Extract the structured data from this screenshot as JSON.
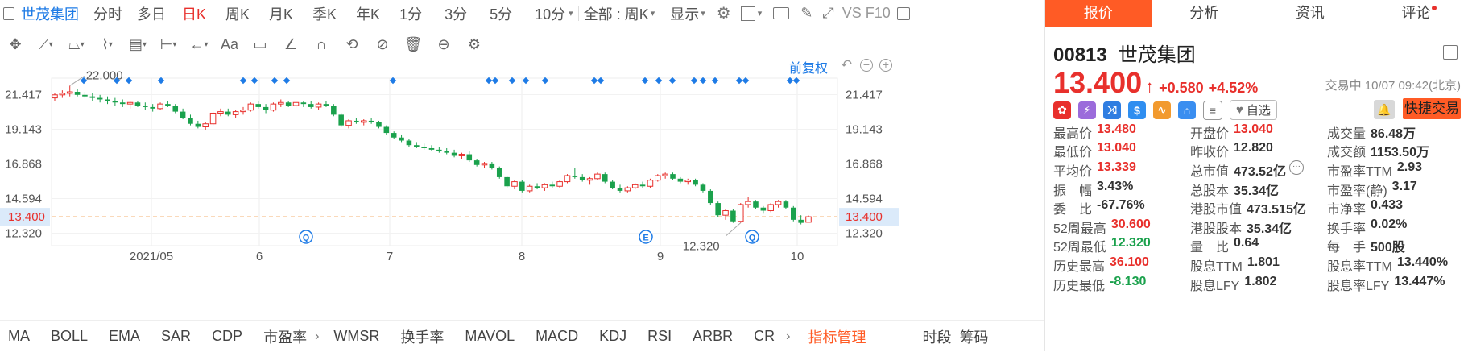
{
  "stock_name": "世茂集团",
  "periods": [
    "分时",
    "多日",
    "日K",
    "周K",
    "月K",
    "季K",
    "年K",
    "1分",
    "3分",
    "5分",
    "10分"
  ],
  "active_period": "日K",
  "range_select": "全部 : 周K",
  "display_label": "显示",
  "vs_label": "VS F10",
  "adjust_label": "前复权",
  "chart_data": {
    "type": "candlestick",
    "title": "",
    "ylim": [
      11.5,
      22.5
    ],
    "y_ticks": [
      21.417,
      19.143,
      16.868,
      14.594,
      12.32
    ],
    "y_tick_labels": [
      "21.417",
      "19.143",
      "16.868",
      "14.594",
      "12.320"
    ],
    "current_price_line": 13.4,
    "current_price_label": "13.400",
    "x_labels": [
      "2021/05",
      "6",
      "7",
      "8",
      "9",
      "10"
    ],
    "max_annotation": "22.000",
    "min_annotation": "12.320",
    "event_markers": [
      "Q",
      "E",
      "Q"
    ],
    "series": [
      {
        "values": [
          [
            21.2,
            21.5,
            21.0,
            21.4
          ],
          [
            21.4,
            21.7,
            21.2,
            21.5
          ],
          [
            21.5,
            22.0,
            21.3,
            21.6
          ],
          [
            21.6,
            21.8,
            21.3,
            21.4
          ],
          [
            21.4,
            21.6,
            21.2,
            21.3
          ],
          [
            21.3,
            21.5,
            21.0,
            21.2
          ],
          [
            21.2,
            21.4,
            20.9,
            21.1
          ],
          [
            21.1,
            21.3,
            20.8,
            21.0
          ],
          [
            21.0,
            21.2,
            20.7,
            20.9
          ],
          [
            20.9,
            21.1,
            20.6,
            20.8
          ],
          [
            20.8,
            21.0,
            20.5,
            20.9
          ],
          [
            20.9,
            21.0,
            20.6,
            20.7
          ],
          [
            20.7,
            20.9,
            20.4,
            20.6
          ],
          [
            20.6,
            20.8,
            20.3,
            20.5
          ],
          [
            20.5,
            20.9,
            20.4,
            20.8
          ],
          [
            20.8,
            21.0,
            20.6,
            20.7
          ],
          [
            20.7,
            20.8,
            20.2,
            20.3
          ],
          [
            20.3,
            20.5,
            19.8,
            19.9
          ],
          [
            19.9,
            20.1,
            19.4,
            19.5
          ],
          [
            19.5,
            19.7,
            19.2,
            19.3
          ],
          [
            19.3,
            19.6,
            19.1,
            19.5
          ],
          [
            19.5,
            20.3,
            19.4,
            20.2
          ],
          [
            20.2,
            20.5,
            20.0,
            20.3
          ],
          [
            20.3,
            20.5,
            20.0,
            20.1
          ],
          [
            20.1,
            20.4,
            19.9,
            20.3
          ],
          [
            20.3,
            20.6,
            20.1,
            20.4
          ],
          [
            20.4,
            20.9,
            20.3,
            20.8
          ],
          [
            20.8,
            21.0,
            20.5,
            20.6
          ],
          [
            20.6,
            20.8,
            20.2,
            20.4
          ],
          [
            20.4,
            20.9,
            20.3,
            20.8
          ],
          [
            20.8,
            21.1,
            20.6,
            20.9
          ],
          [
            20.9,
            21.0,
            20.6,
            20.7
          ],
          [
            20.7,
            21.0,
            20.5,
            20.9
          ],
          [
            20.9,
            21.0,
            20.6,
            20.8
          ],
          [
            20.8,
            21.0,
            20.5,
            20.6
          ],
          [
            20.6,
            20.9,
            20.4,
            20.8
          ],
          [
            20.8,
            21.0,
            20.6,
            20.7
          ],
          [
            20.7,
            20.8,
            20.0,
            20.1
          ],
          [
            20.1,
            20.2,
            19.3,
            19.4
          ],
          [
            19.4,
            19.8,
            19.2,
            19.7
          ],
          [
            19.7,
            19.9,
            19.5,
            19.6
          ],
          [
            19.6,
            19.8,
            19.4,
            19.7
          ],
          [
            19.7,
            19.9,
            19.5,
            19.6
          ],
          [
            19.6,
            19.7,
            19.2,
            19.3
          ],
          [
            19.3,
            19.4,
            18.8,
            18.9
          ],
          [
            18.9,
            19.0,
            18.5,
            18.6
          ],
          [
            18.6,
            18.8,
            18.3,
            18.4
          ],
          [
            18.4,
            18.5,
            18.0,
            18.1
          ],
          [
            18.1,
            18.3,
            17.9,
            18.0
          ],
          [
            18.0,
            18.2,
            17.8,
            17.9
          ],
          [
            17.9,
            18.1,
            17.7,
            17.8
          ],
          [
            17.8,
            18.0,
            17.6,
            17.7
          ],
          [
            17.7,
            17.9,
            17.5,
            17.6
          ],
          [
            17.6,
            17.8,
            17.3,
            17.4
          ],
          [
            17.4,
            17.6,
            17.2,
            17.5
          ],
          [
            17.5,
            17.7,
            17.0,
            17.1
          ],
          [
            17.1,
            17.2,
            16.7,
            16.8
          ],
          [
            16.8,
            17.0,
            16.6,
            16.9
          ],
          [
            16.9,
            17.0,
            16.5,
            16.6
          ],
          [
            16.6,
            16.7,
            15.9,
            16.0
          ],
          [
            16.0,
            16.1,
            15.3,
            15.4
          ],
          [
            15.4,
            15.8,
            15.2,
            15.7
          ],
          [
            15.7,
            15.8,
            15.0,
            15.1
          ],
          [
            15.1,
            15.5,
            15.0,
            15.4
          ],
          [
            15.4,
            15.6,
            15.2,
            15.3
          ],
          [
            15.3,
            15.6,
            15.1,
            15.5
          ],
          [
            15.5,
            15.7,
            15.3,
            15.4
          ],
          [
            15.4,
            15.8,
            15.3,
            15.7
          ],
          [
            15.7,
            16.2,
            15.6,
            16.1
          ],
          [
            16.1,
            16.6,
            15.9,
            16.0
          ],
          [
            16.0,
            16.2,
            15.7,
            15.8
          ],
          [
            15.8,
            16.0,
            15.5,
            15.9
          ],
          [
            15.9,
            16.3,
            15.8,
            16.2
          ],
          [
            16.2,
            16.3,
            15.6,
            15.7
          ],
          [
            15.7,
            15.8,
            15.2,
            15.3
          ],
          [
            15.3,
            15.5,
            15.0,
            15.1
          ],
          [
            15.1,
            15.4,
            15.0,
            15.3
          ],
          [
            15.3,
            15.6,
            15.2,
            15.5
          ],
          [
            15.5,
            15.7,
            15.3,
            15.4
          ],
          [
            15.4,
            15.9,
            15.3,
            15.8
          ],
          [
            15.8,
            16.2,
            15.7,
            16.1
          ],
          [
            16.1,
            16.3,
            15.9,
            16.2
          ],
          [
            16.2,
            16.3,
            15.8,
            15.9
          ],
          [
            15.9,
            16.0,
            15.6,
            15.7
          ],
          [
            15.7,
            15.9,
            15.5,
            15.8
          ],
          [
            15.8,
            15.9,
            15.4,
            15.5
          ],
          [
            15.5,
            15.6,
            15.0,
            15.1
          ],
          [
            15.1,
            15.2,
            14.2,
            14.3
          ],
          [
            14.3,
            14.4,
            13.4,
            13.5
          ],
          [
            13.5,
            13.9,
            13.2,
            13.8
          ],
          [
            13.8,
            13.9,
            13.0,
            13.1
          ],
          [
            13.1,
            14.3,
            13.0,
            14.2
          ],
          [
            14.2,
            14.7,
            14.0,
            14.4
          ],
          [
            14.4,
            14.5,
            13.9,
            14.0
          ],
          [
            14.0,
            14.1,
            13.6,
            13.8
          ],
          [
            13.8,
            14.3,
            13.7,
            14.2
          ],
          [
            14.2,
            14.5,
            14.0,
            14.4
          ],
          [
            14.4,
            14.5,
            13.9,
            14.0
          ],
          [
            14.0,
            14.1,
            13.1,
            13.2
          ],
          [
            13.2,
            13.5,
            12.9,
            13.0
          ],
          [
            13.04,
            13.48,
            13.04,
            13.4
          ]
        ]
      }
    ]
  },
  "indicators": [
    "MA",
    "BOLL",
    "EMA",
    "SAR",
    "CDP",
    "市盈率",
    "WMSR",
    "换手率",
    "MAVOL",
    "MACD",
    "KDJ",
    "RSI",
    "ARBR",
    "CR"
  ],
  "indicator_manage": "指标管理",
  "bottom_right": [
    "时段",
    "筹码"
  ],
  "right_tabs": [
    "报价",
    "分析",
    "资讯",
    "评论"
  ],
  "quote": {
    "code": "00813",
    "name": "世茂集团",
    "price": "13.400",
    "change": "+0.580",
    "change_pct": "+4.52%",
    "status_time": "交易中 10/07 09:42(北京)",
    "watch_label": "自选",
    "fast_trade_label": "快捷交易"
  },
  "stats": [
    [
      {
        "label": "最高价",
        "value": "13.480",
        "color": "up"
      },
      {
        "label": "开盘价",
        "value": "13.040",
        "color": "up"
      },
      {
        "label": "成交量",
        "value": "86.48万"
      }
    ],
    [
      {
        "label": "最低价",
        "value": "13.040",
        "color": "up"
      },
      {
        "label": "昨收价",
        "value": "12.820"
      },
      {
        "label": "成交额",
        "value": "1153.50万"
      }
    ],
    [
      {
        "label": "平均价",
        "value": "13.339",
        "color": "up"
      },
      {
        "label": "总市值",
        "value": "473.52亿"
      },
      {
        "label": "市盈率TTM",
        "value": "2.93"
      }
    ],
    [
      {
        "label": "振　幅",
        "value": "3.43%"
      },
      {
        "label": "总股本",
        "value": "35.34亿"
      },
      {
        "label": "市盈率(静)",
        "value": "3.17"
      }
    ],
    [
      {
        "label": "委　比",
        "value": "-67.76%"
      },
      {
        "label": "港股市值",
        "value": "473.515亿"
      },
      {
        "label": "市净率",
        "value": "0.433"
      }
    ],
    [
      {
        "label": "52周最高",
        "value": "30.600",
        "color": "up"
      },
      {
        "label": "港股股本",
        "value": "35.34亿"
      },
      {
        "label": "换手率",
        "value": "0.02%"
      }
    ],
    [
      {
        "label": "52周最低",
        "value": "12.320",
        "color": "down"
      },
      {
        "label": "量　比",
        "value": "0.64"
      },
      {
        "label": "每　手",
        "value": "500股"
      }
    ],
    [
      {
        "label": "历史最高",
        "value": "36.100",
        "color": "up"
      },
      {
        "label": "股息TTM",
        "value": "1.801"
      },
      {
        "label": "股息率TTM",
        "value": "13.440%"
      }
    ],
    [
      {
        "label": "历史最低",
        "value": "-8.130",
        "color": "down"
      },
      {
        "label": "股息LFY",
        "value": "1.802"
      },
      {
        "label": "股息率LFY",
        "value": "13.447%"
      }
    ]
  ],
  "colors": {
    "up": "#e8302c",
    "down": "#1aa14c",
    "accent": "#ff5b25",
    "link": "#1e7be6"
  }
}
